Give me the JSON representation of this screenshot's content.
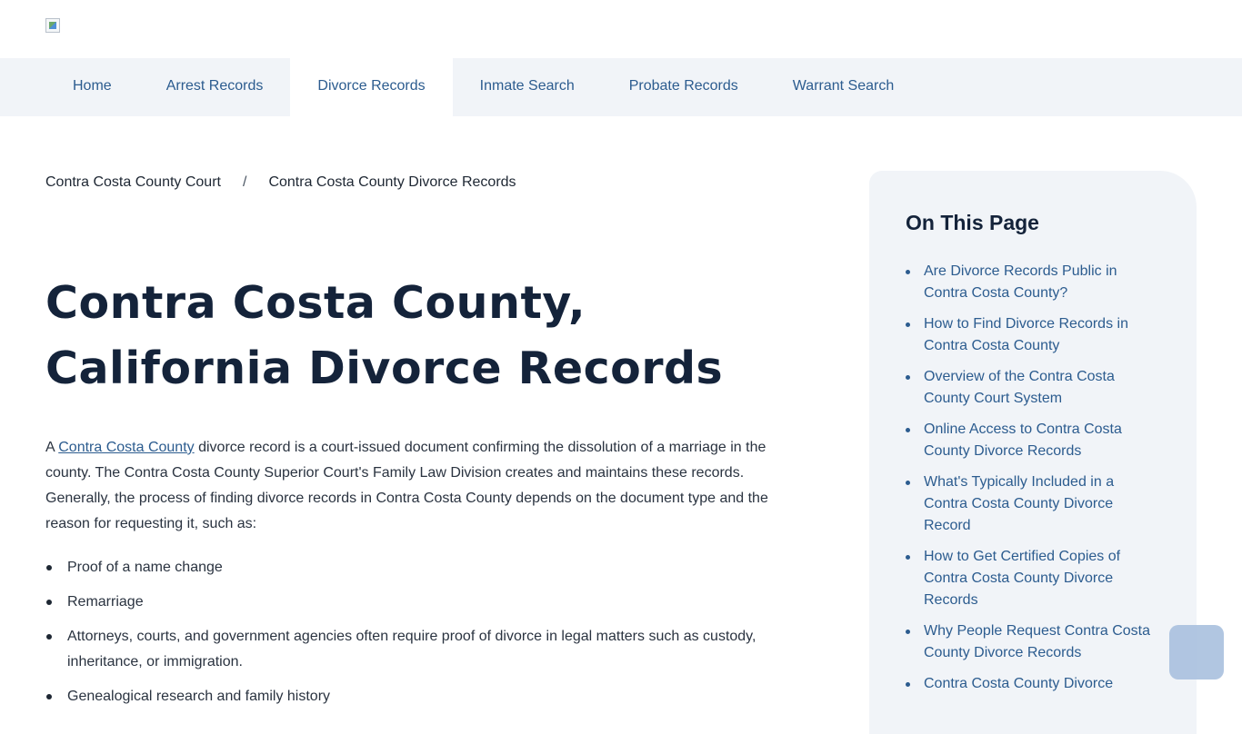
{
  "nav": {
    "items": [
      {
        "label": "Home"
      },
      {
        "label": "Arrest Records"
      },
      {
        "label": "Divorce Records"
      },
      {
        "label": "Inmate Search"
      },
      {
        "label": "Probate Records"
      },
      {
        "label": "Warrant Search"
      }
    ],
    "active_index": 2
  },
  "breadcrumb": {
    "items": [
      "Contra Costa County Court",
      "Contra Costa County Divorce Records"
    ],
    "separator": "/"
  },
  "page": {
    "title": "Contra Costa County, California Divorce Records",
    "intro_prefix": "A ",
    "intro_link": "Contra Costa County",
    "intro_rest": " divorce record is a court-issued document confirming the dissolution of a marriage in the county. The Contra Costa County Superior Court's Family Law Division creates and maintains these records. Generally, the process of finding divorce records in Contra Costa County depends on the document type and the reason for requesting it, such as:",
    "bullets": [
      "Proof of a name change",
      "Remarriage",
      "Attorneys, courts, and government agencies often require proof of divorce in legal matters such as custody, inheritance, or immigration.",
      "Genealogical research and family history"
    ]
  },
  "toc": {
    "title": "On This Page",
    "items": [
      "Are Divorce Records Public in Contra Costa County?",
      "How to Find Divorce Records in Contra Costa County",
      "Overview of the Contra Costa County Court System",
      "Online Access to Contra Costa County Divorce Records",
      "What's Typically Included in a Contra Costa County Divorce Record",
      "How to Get Certified Copies of Contra Costa County Divorce Records",
      "Why People Request Contra Costa County Divorce Records",
      "Contra Costa County Divorce"
    ]
  },
  "colors": {
    "nav_bg": "#f1f4f8",
    "link": "#2c5c8f",
    "heading": "#14233a",
    "float_button": "#a9c0de"
  }
}
